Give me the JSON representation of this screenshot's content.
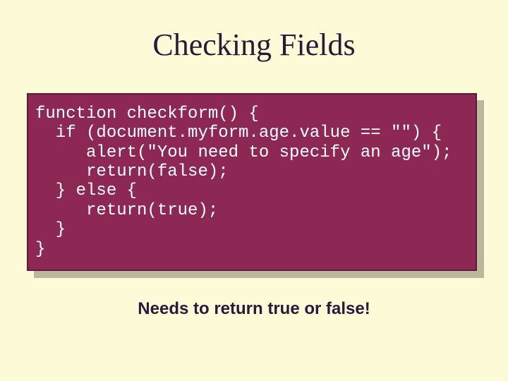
{
  "title": "Checking Fields",
  "code": {
    "l1": "function checkform() {",
    "l2": "  if (document.myform.age.value == \"\") {",
    "l3": "     alert(\"You need to specify an age\");",
    "l4": "     return(false);",
    "l5": "  } else {",
    "l6": "     return(true);",
    "l7": "  }",
    "l8": "}"
  },
  "caption": "Needs to return true or false!"
}
